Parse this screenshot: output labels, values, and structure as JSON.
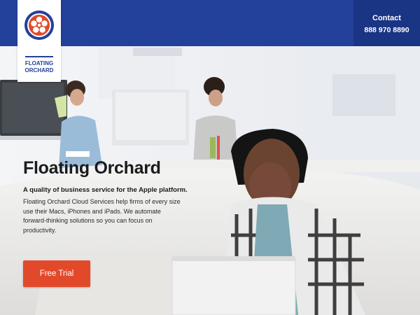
{
  "brand": {
    "name_line1": "FLOATING",
    "name_line2": "ORCHARD",
    "color": "#23409a",
    "logo_icon": "orchard-flower-icon"
  },
  "header": {
    "background": "#23409a",
    "contact_label": "Contact",
    "phone": "888 970 8890"
  },
  "hero": {
    "headline": "Floating Orchard",
    "tagline": "A quality of business service for the Apple platform.",
    "body": "Floating Orchard Cloud Services help firms of every size use their Macs, iPhones and iPads. We automate forward-thinking solutions so you can focus on productivity.",
    "cta_label": "Free Trial",
    "cta_color": "#e2492a",
    "photo": "office-photo-man-with-laptop"
  }
}
